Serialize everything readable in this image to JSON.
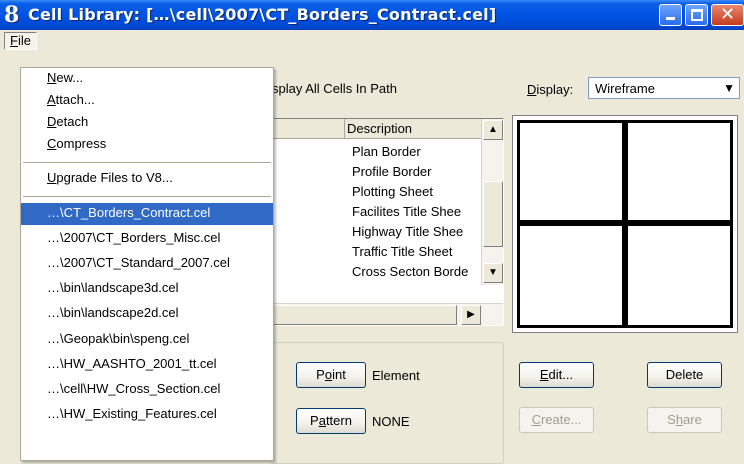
{
  "window": {
    "title": "Cell Library: […\\cell\\2007\\CT_Borders_Contract.cel]",
    "icon_glyph": "8",
    "close_glyph": "✕"
  },
  "menubar": {
    "file_label": "File"
  },
  "file_menu": {
    "items": [
      {
        "label": "New...",
        "key": "N"
      },
      {
        "label": "Attach...",
        "key": "A"
      },
      {
        "label": "Detach",
        "key": "D"
      },
      {
        "label": "Compress",
        "key": "C"
      },
      {
        "label": "Upgrade Files to V8...",
        "key": "U"
      }
    ],
    "recent": [
      {
        "label": "…\\CT_Borders_Contract.cel",
        "highlighted": true
      },
      {
        "label": "…\\2007\\CT_Borders_Misc.cel",
        "highlighted": false
      },
      {
        "label": "…\\2007\\CT_Standard_2007.cel",
        "highlighted": false
      },
      {
        "label": "…\\bin\\landscape3d.cel",
        "highlighted": false
      },
      {
        "label": "…\\bin\\landscape2d.cel",
        "highlighted": false
      },
      {
        "label": "…\\Geopak\\bin\\speng.cel",
        "highlighted": false
      },
      {
        "label": "…\\HW_AASHTO_2001_tt.cel",
        "highlighted": false
      },
      {
        "label": "…\\cell\\HW_Cross_Section.cel",
        "highlighted": false
      },
      {
        "label": "…\\HW_Existing_Features.cel",
        "highlighted": false
      }
    ],
    "highlight_color": "#316ac5"
  },
  "main": {
    "path_checkbox_label": "splay All Cells In Path",
    "display_label": "Display:",
    "display_value": "Wireframe",
    "description_header": "Description",
    "descriptions": [
      "Plan Border",
      "Profile Border",
      "Plotting Sheet",
      "Facilites Title Shee",
      "Highway Title Shee",
      "Traffic Title Sheet",
      "Cross Secton Borde"
    ],
    "scroll_up_glyph": "▲",
    "scroll_down_glyph": "▼",
    "scroll_right_glyph": "▶"
  },
  "placement": {
    "point_button": "Point",
    "point_value": "Element",
    "pattern_button": "Pattern",
    "pattern_value": "NONE"
  },
  "actions": {
    "edit": "Edit...",
    "delete": "Delete",
    "create": "Create...",
    "share": "Share"
  },
  "colors": {
    "titlebar": "#0054e3",
    "face": "#ece9d8"
  }
}
